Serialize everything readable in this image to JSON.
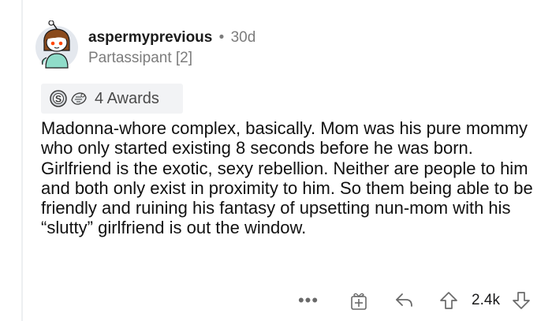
{
  "comment": {
    "username": "aspermyprevious",
    "separator": "•",
    "time_ago": "30d",
    "flair": "Partassipant [2]",
    "awards_label": "4 Awards",
    "award_icons": [
      "silver-award-icon",
      "wholesome-award-icon"
    ],
    "body": "Madonna-whore complex, basically. Mom was his pure mommy who only started existing 8 seconds before he was born. Girlfriend is the exotic, sexy rebellion. Neither are people to him and both only exist in proximity to him. So them being able to be friendly and ruining his fantasy of upsetting nun-mom with his “slutty” girlfriend is out the window."
  },
  "actions": {
    "more_label": "•••",
    "vote_count": "2.4k",
    "icons": [
      "more-icon",
      "gift-award-icon",
      "reply-icon",
      "upvote-icon",
      "downvote-icon"
    ]
  },
  "colors": {
    "text": "#1a1a1b",
    "meta": "#7c7c7c",
    "awards_bg": "#f2f3f5",
    "avatar_bg": "#e4e8ee",
    "avatar_shirt": "#8fdcc9",
    "avatar_hair": "#8a4a1c",
    "icon": "#6a6a6a"
  }
}
